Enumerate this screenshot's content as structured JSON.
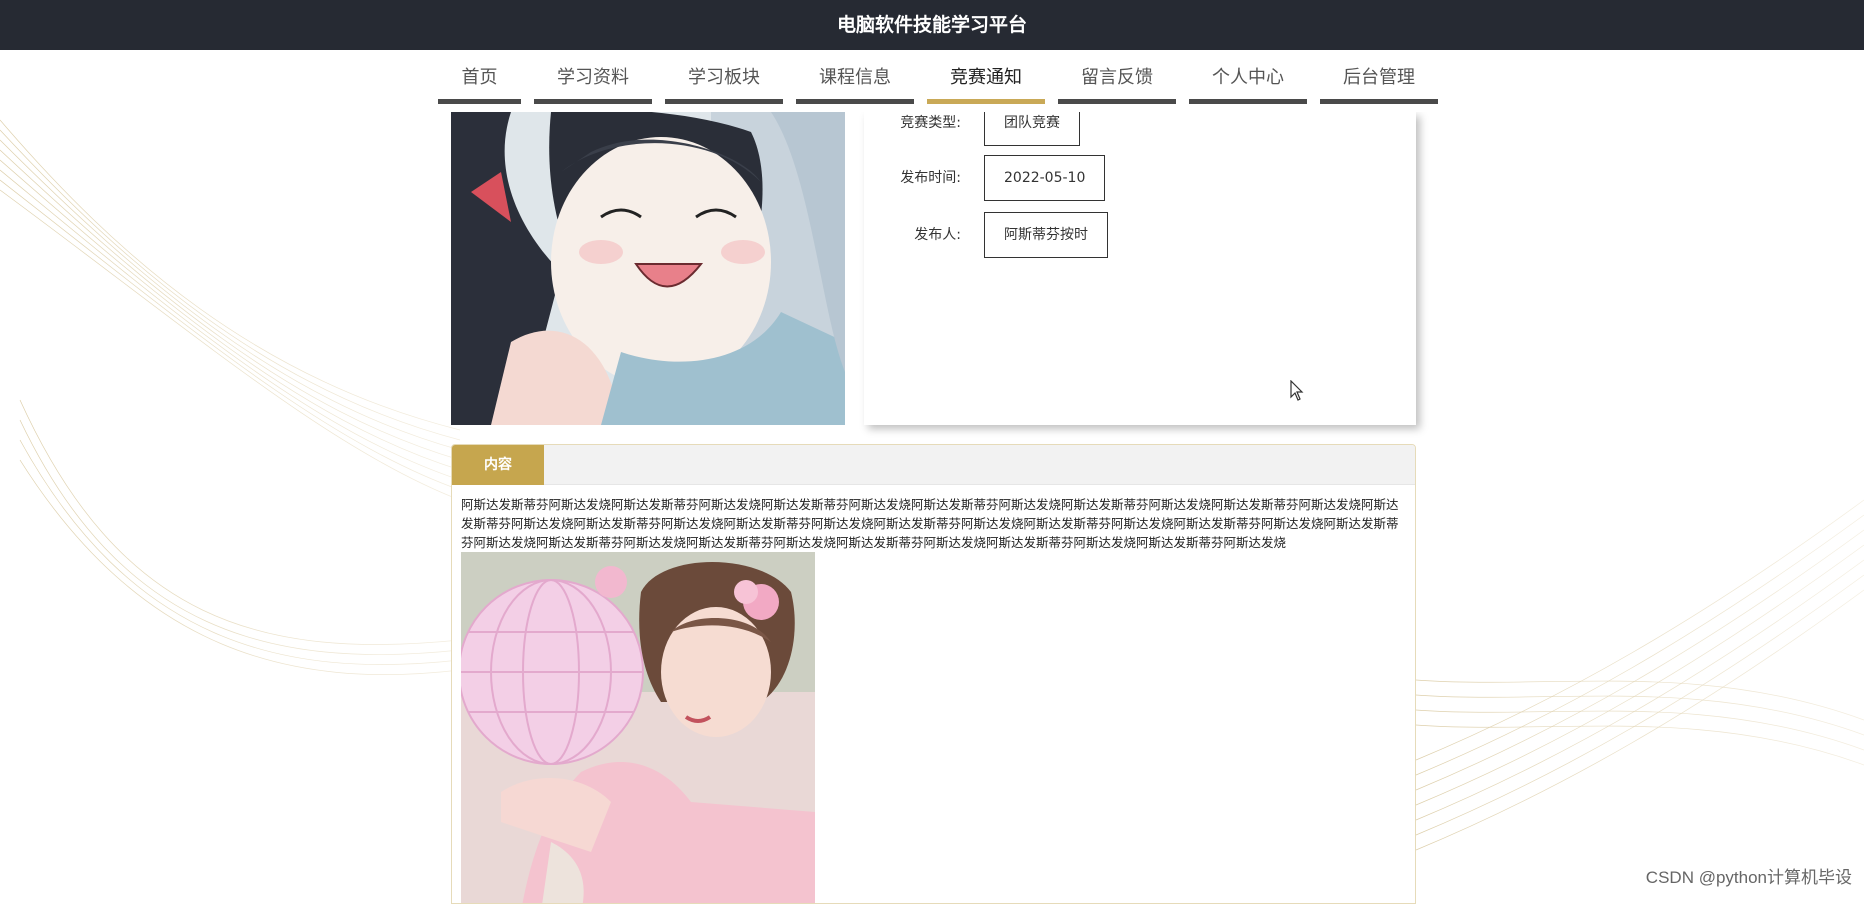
{
  "app": {
    "title": "电脑软件技能学习平台"
  },
  "nav": {
    "items": [
      {
        "label": "首页",
        "active": false
      },
      {
        "label": "学习资料",
        "active": false
      },
      {
        "label": "学习板块",
        "active": false
      },
      {
        "label": "课程信息",
        "active": false
      },
      {
        "label": "竞赛通知",
        "active": true
      },
      {
        "label": "留言反馈",
        "active": false
      },
      {
        "label": "个人中心",
        "active": false
      },
      {
        "label": "后台管理",
        "active": false
      }
    ]
  },
  "detail": {
    "fields": [
      {
        "label": "竞赛类型:",
        "value": "团队竞赛"
      },
      {
        "label": "发布时间:",
        "value": "2022-05-10"
      },
      {
        "label": "发布人:",
        "value": "阿斯蒂芬按时"
      }
    ]
  },
  "content": {
    "tab_label": "内容",
    "text": "阿斯达发斯蒂芬阿斯达发烧阿斯达发斯蒂芬阿斯达发烧阿斯达发斯蒂芬阿斯达发烧阿斯达发斯蒂芬阿斯达发烧阿斯达发斯蒂芬阿斯达发烧阿斯达发斯蒂芬阿斯达发烧阿斯达发斯蒂芬阿斯达发烧阿斯达发斯蒂芬阿斯达发烧阿斯达发斯蒂芬阿斯达发烧阿斯达发斯蒂芬阿斯达发烧阿斯达发斯蒂芬阿斯达发烧阿斯达发斯蒂芬阿斯达发烧阿斯达发斯蒂芬阿斯达发烧阿斯达发斯蒂芬阿斯达发烧阿斯达发斯蒂芬阿斯达发烧阿斯达发斯蒂芬阿斯达发烧阿斯达发斯蒂芬阿斯达发烧阿斯达发斯蒂芬阿斯达发烧"
  },
  "watermark": "CSDN @python计算机毕设",
  "colors": {
    "topbar_bg": "#262a33",
    "accent_gold": "#c6a64e",
    "nav_underline": "#4a4a4a"
  }
}
